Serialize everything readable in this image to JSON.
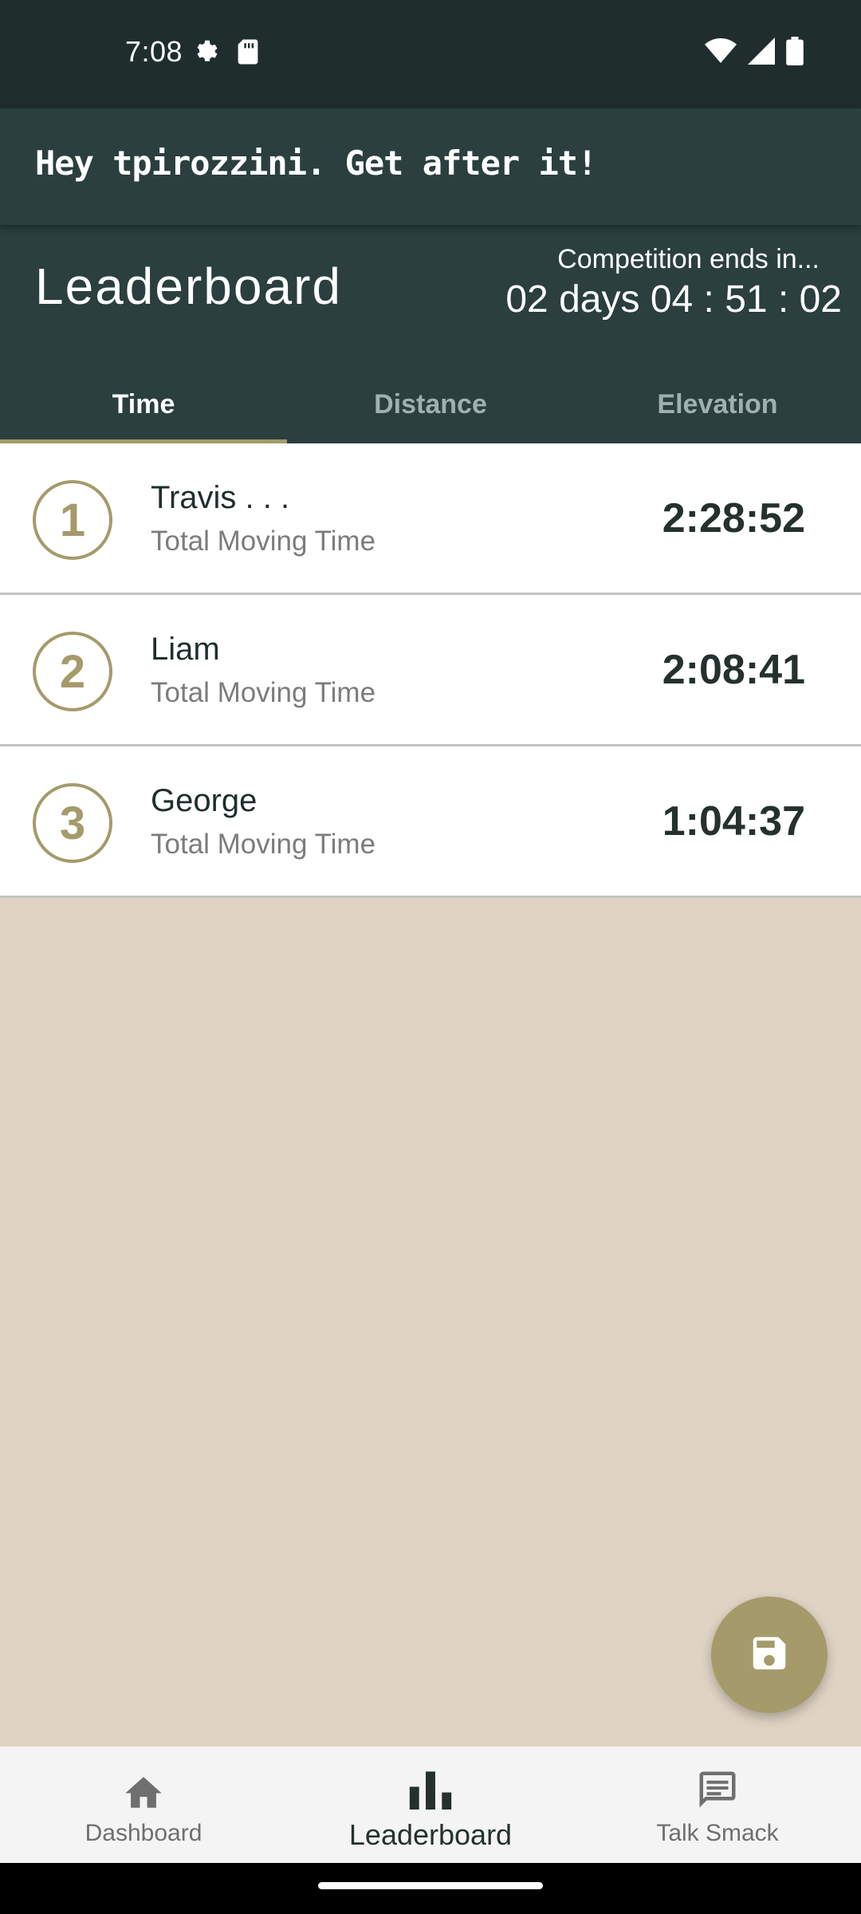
{
  "status": {
    "time": "7:08",
    "icons_left": [
      "settings-icon",
      "sd-card-icon"
    ],
    "icons_right": [
      "wifi-icon",
      "signal-icon",
      "battery-icon"
    ]
  },
  "greeting": "Hey tpirozzini. Get after it!",
  "header": {
    "title": "Leaderboard",
    "competition_label": "Competition ends in...",
    "countdown": "02 days 04 : 51 : 02"
  },
  "tabs": [
    {
      "label": "Time",
      "active": true
    },
    {
      "label": "Distance",
      "active": false
    },
    {
      "label": "Elevation",
      "active": false
    }
  ],
  "leaderboard": [
    {
      "rank": "1",
      "name": "Travis . . .",
      "metric": "Total Moving Time",
      "value": "2:28:52"
    },
    {
      "rank": "2",
      "name": "Liam",
      "metric": "Total Moving Time",
      "value": "2:08:41"
    },
    {
      "rank": "3",
      "name": "George",
      "metric": "Total Moving Time",
      "value": "1:04:37"
    }
  ],
  "fab": {
    "icon": "save-icon"
  },
  "bottom_nav": [
    {
      "label": "Dashboard",
      "icon": "home-icon",
      "active": false
    },
    {
      "label": "Leaderboard",
      "icon": "bar-chart-icon",
      "active": true
    },
    {
      "label": "Talk Smack",
      "icon": "chat-icon",
      "active": false
    }
  ],
  "colors": {
    "primary_dark": "#1F2E2D",
    "primary": "#2A3F3E",
    "accent": "#A59A6A",
    "background": "#DFD3C3"
  }
}
